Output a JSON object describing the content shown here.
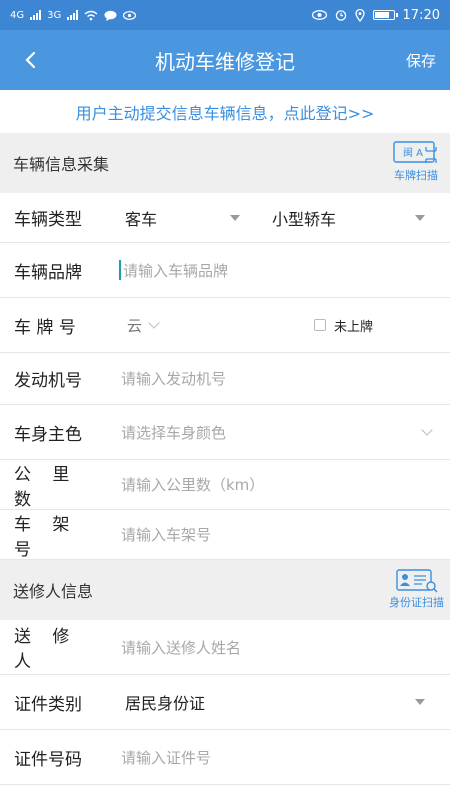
{
  "status": {
    "network_left": "4G",
    "network_right": "3G",
    "time": "17:20"
  },
  "appbar": {
    "title": "机动车维修登记",
    "save_label": "保存",
    "back_icon": "chevron-left-icon"
  },
  "hint_link": "用户主动提交信息车辆信息，点此登记>>",
  "vehicle_section": {
    "title": "车辆信息采集",
    "scan_label": "车牌扫描",
    "scan_icon_text": "闽 A"
  },
  "vehicle_fields": {
    "type_label": "车辆类型",
    "type_value": "客车",
    "subtype_value": "小型轿车",
    "brand_label": "车辆品牌",
    "brand_placeholder": "请输入车辆品牌",
    "plate_label": "车 牌 号",
    "plate_prefix": "云",
    "unplated_label": "未上牌",
    "engine_label": "发动机号",
    "engine_placeholder": "请输入发动机号",
    "color_label": "车身主色",
    "color_placeholder": "请选择车身颜色",
    "mileage_label": "公 里 数",
    "mileage_placeholder": "请输入公里数（km）",
    "frame_label": "车 架 号",
    "frame_placeholder": "请输入车架号"
  },
  "sender_section": {
    "title": "送修人信息",
    "scan_label": "身份证扫描"
  },
  "sender_fields": {
    "name_label": "送 修 人",
    "name_placeholder": "请输入送修人姓名",
    "idtype_label": "证件类别",
    "idtype_value": "居民身份证",
    "idno_label": "证件号码",
    "idno_placeholder": "请输入证件号"
  },
  "colors": {
    "appbar": "#4a97e0",
    "statusbar": "#3d86d4",
    "accent": "#3a8fe0"
  }
}
